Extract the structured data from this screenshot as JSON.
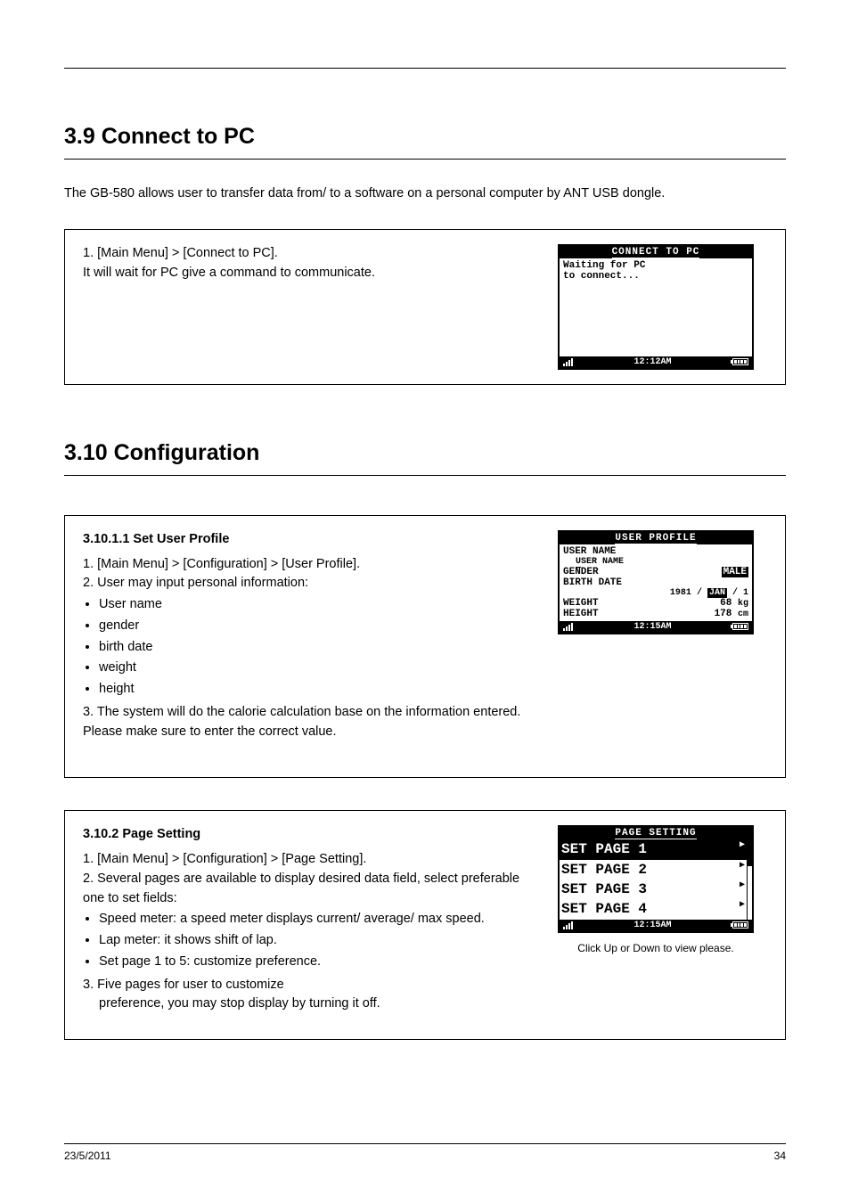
{
  "header": {
    "rule": true
  },
  "sections": {
    "connect": {
      "title": "3.9 Connect to PC",
      "intro": "The GB-580 allows user to transfer data from/ to a software on a personal computer by ANT USB dongle.",
      "box": {
        "steps": "1. [Main Menu] > [Connect to PC].",
        "after": "It will wait for PC give a command to communicate."
      },
      "device": {
        "title": "CONNECT TO PC",
        "line1": "Waiting for PC",
        "line2": "to connect...",
        "time": "12:12AM"
      }
    },
    "config": {
      "title": "3.10 Configuration",
      "profile": {
        "box": {
          "header": "3.10.1.1 Set User Profile",
          "steps": "1. [Main Menu] > [Configuration] > [User Profile].",
          "item2": "2. User may input personal information:",
          "list": [
            "User name",
            "gender",
            "birth date",
            "weight",
            "height"
          ],
          "item3": "3. The system will do the calorie calculation base on the information entered. Please make sure to enter the correct value."
        },
        "device": {
          "title": "USER PROFILE",
          "user_name_label": "USER NAME",
          "user_name_value": "USER NAME",
          "gender_label": "GENDER",
          "gender_value": "MALE",
          "birth_label": "BIRTH DATE",
          "birth_year": "1981",
          "birth_month": "JAN",
          "birth_day": "1",
          "weight_label": "WEIGHT",
          "weight_value": "68",
          "weight_unit": "kg",
          "height_label": "HEIGHT",
          "height_value": "178",
          "height_unit": "cm",
          "time": "12:15AM"
        }
      },
      "page_setting": {
        "box": {
          "header": "3.10.2 Page Setting",
          "steps": "1. [Main Menu] > [Configuration] > [Page Setting].",
          "item2": "2. Several pages are available to display desired data field, select preferable one to set fields:",
          "list": [
            "Speed meter: a speed meter displays current/ average/ max speed.",
            "Lap meter: it shows shift of lap.",
            "Set page 1 to 5: customize preference."
          ],
          "item3_1": "3. Five pages for user to customize",
          "item3_2": "preference, you may stop display by turning it off."
        },
        "device": {
          "title": "PAGE SETTING",
          "items": [
            "SET PAGE 1",
            "SET PAGE 2",
            "SET PAGE 3",
            "SET PAGE 4"
          ],
          "time": "12:15AM"
        },
        "hint": "Click Up or Down to view please."
      }
    }
  },
  "footer": {
    "date": "23/5/2011",
    "page": "34"
  }
}
